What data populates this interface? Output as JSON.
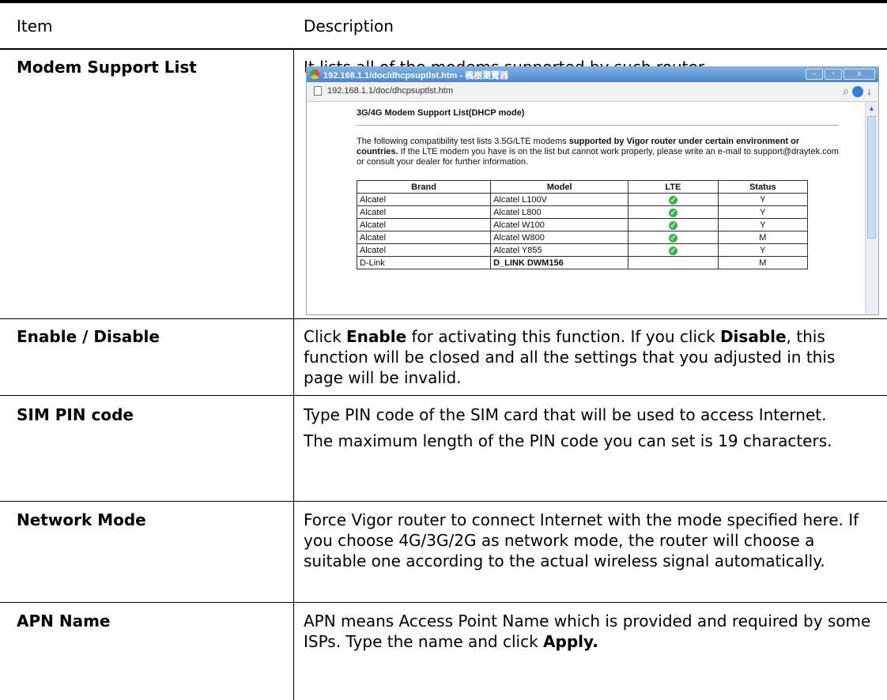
{
  "table": {
    "headers": {
      "item": "Item",
      "description": "Description"
    },
    "rows": [
      {
        "item": "Modem Support List",
        "paragraphs": [
          {
            "parts": [
              {
                "text": "It lists all of the modems supported by such router.",
                "bold": false
              }
            ]
          }
        ]
      },
      {
        "item": "Enable / Disable",
        "paragraphs": [
          {
            "parts": [
              {
                "text": "Click ",
                "bold": false
              },
              {
                "text": "Enable",
                "bold": true
              },
              {
                "text": " for activating this function. If you click ",
                "bold": false
              },
              {
                "text": "Disable",
                "bold": true
              },
              {
                "text": ", this function will be closed and all the settings that you adjusted in this page will be invalid.",
                "bold": false
              }
            ]
          }
        ]
      },
      {
        "item": "SIM PIN code",
        "paragraphs": [
          {
            "parts": [
              {
                "text": "Type PIN code of the SIM card that will be used to access Internet.",
                "bold": false
              }
            ]
          },
          {
            "parts": [
              {
                "text": "The maximum length of the PIN code you can set is 19 characters.",
                "bold": false
              }
            ]
          }
        ]
      },
      {
        "item": "Network Mode",
        "paragraphs": [
          {
            "parts": [
              {
                "text": "Force Vigor router to connect Internet with the mode specified here. If you choose 4G/3G/2G as network mode, the router will choose a suitable one according to the actual wireless signal automatically.",
                "bold": false
              }
            ]
          }
        ]
      },
      {
        "item": "APN Name",
        "paragraphs": [
          {
            "parts": [
              {
                "text": "APN means Access Point Name which is provided and required by some ISPs. Type the name and click ",
                "bold": false
              },
              {
                "text": "Apply.",
                "bold": true
              }
            ]
          }
        ]
      }
    ]
  },
  "screenshot": {
    "window_title": "192.168.1.1/doc/dhcpsuptlst.htm - 楓樹瀏覽器",
    "window_buttons": [
      "–",
      "▫",
      "x"
    ],
    "url": "192.168.1.1/doc/dhcpsuptlst.htm",
    "heading": "3G/4G Modem Support List(DHCP mode)",
    "intro_parts": [
      {
        "text": "The following compatibility test lists 3.5G/LTE modems ",
        "bold": false
      },
      {
        "text": "supported by Vigor router under certain environment or countries.",
        "bold": true
      },
      {
        "text": " If the LTE modem you have is on the list but cannot work properly, please write an e-mail to support@draytek.com or consult your dealer for further information.",
        "bold": false
      }
    ],
    "columns": [
      "Brand",
      "Model",
      "LTE",
      "Status"
    ],
    "rows": [
      {
        "brand": "Alcatel",
        "model": "Alcatel L100V",
        "lte": true,
        "status": "Y"
      },
      {
        "brand": "Alcatel",
        "model": "Alcatel L800",
        "lte": true,
        "status": "Y"
      },
      {
        "brand": "Alcatel",
        "model": "Alcatel W100",
        "lte": true,
        "status": "Y"
      },
      {
        "brand": "Alcatel",
        "model": "Alcatel W800",
        "lte": true,
        "status": "M"
      },
      {
        "brand": "Alcatel",
        "model": "Alcatel Y855",
        "lte": true,
        "status": "Y"
      },
      {
        "brand": "D-Link",
        "model": "D_LINK DWM156",
        "lte": false,
        "status": "M"
      }
    ],
    "accent_color": "#4b86c8",
    "check_color": "#3bb54a"
  }
}
